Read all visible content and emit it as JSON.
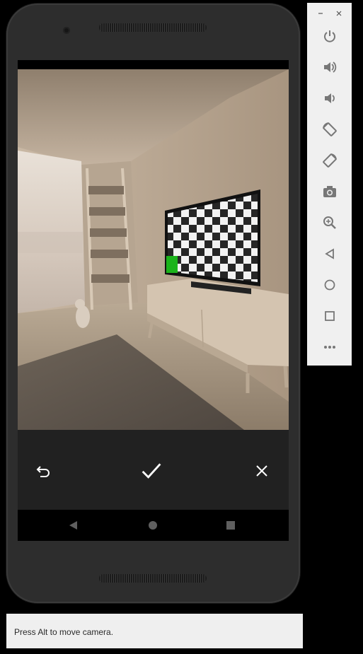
{
  "status_bar": {
    "hint": "Press Alt to move camera."
  },
  "camera_review": {
    "actions": [
      "retake-icon",
      "accept-check-icon",
      "cancel-close-icon"
    ]
  },
  "android_nav": [
    "back-icon",
    "home-icon",
    "recents-icon"
  ],
  "emulator_toolbar": {
    "window_controls": [
      "minimize-icon",
      "close-icon"
    ],
    "tools": [
      "power-icon",
      "volume-up-icon",
      "volume-down-icon",
      "rotate-left-icon",
      "rotate-right-icon",
      "screenshot-camera-icon",
      "zoom-icon",
      "back-icon",
      "home-icon",
      "overview-icon",
      "more-icon"
    ]
  },
  "colors": {
    "phone_body": "#2d2d2d",
    "action_bar": "#212121",
    "toolbar_bg": "#f0f0f0",
    "status_bg": "#efefef",
    "icon_gray": "#777777",
    "marker_green": "#1bb31b"
  }
}
